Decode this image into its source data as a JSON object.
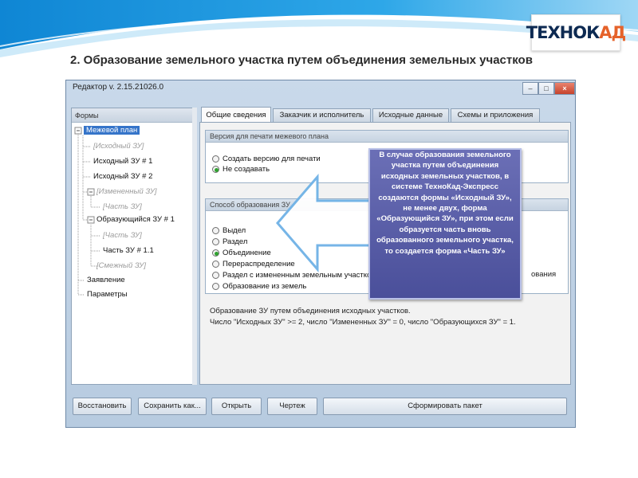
{
  "slide": {
    "logo_tekhno": "ТЕХНО",
    "logo_k": "К",
    "logo_ad": "АД",
    "title": "2. Образование земельного участка путем объединения земельных участков"
  },
  "window": {
    "title": "Редактор v. 2.15.21026.0",
    "min_label": "–",
    "max_label": "□",
    "close_label": "×"
  },
  "tree": {
    "header": "Формы",
    "items": [
      {
        "label": "Межевой план",
        "style": "selected"
      },
      {
        "label": "[Исходный ЗУ]",
        "style": "ghost"
      },
      {
        "label": "Исходный ЗУ # 1",
        "style": "normal"
      },
      {
        "label": "Исходный ЗУ # 2",
        "style": "normal"
      },
      {
        "label": "[Измененный ЗУ]",
        "style": "ghost"
      },
      {
        "label": "[Часть ЗУ]",
        "style": "ghost"
      },
      {
        "label": "Образующийся ЗУ # 1",
        "style": "normal"
      },
      {
        "label": "[Часть ЗУ]",
        "style": "ghost"
      },
      {
        "label": "Часть ЗУ # 1.1",
        "style": "normal"
      },
      {
        "label": "[Смежный ЗУ]",
        "style": "ghost"
      },
      {
        "label": "Заявление",
        "style": "normal"
      },
      {
        "label": "Параметры",
        "style": "normal"
      }
    ]
  },
  "tabs": [
    {
      "label": "Общие сведения",
      "active": true
    },
    {
      "label": "Заказчик и исполнитель",
      "active": false
    },
    {
      "label": "Исходные данные",
      "active": false
    },
    {
      "label": "Схемы и приложения",
      "active": false
    }
  ],
  "print_version": {
    "header": "Версия для печати межевого плана",
    "options": [
      {
        "label": "Создать версию для печати",
        "checked": false
      },
      {
        "label": "Не создавать",
        "checked": true
      }
    ]
  },
  "method": {
    "header": "Способ образования ЗУ",
    "options": [
      {
        "label": "Выдел",
        "checked": false
      },
      {
        "label": "Раздел",
        "checked": false
      },
      {
        "label": "Объединение",
        "checked": true
      },
      {
        "label": "Перераспределение",
        "checked": false
      },
      {
        "label": "Раздел с измененным земельным участком",
        "checked": false
      },
      {
        "label": "Образование из земель",
        "checked": false
      }
    ],
    "trailing_text": "ования",
    "note_line1": "Образование ЗУ путем объединения исходных участков.",
    "note_line2": "Число \"Исходных ЗУ\" >= 2, число \"Измененных ЗУ\" = 0, число \"Образующихся ЗУ\" = 1."
  },
  "buttons": {
    "restore": "Восстановить",
    "save_as": "Сохранить как...",
    "open": "Открыть",
    "drawing": "Чертеж",
    "build_package": "Сформировать пакет"
  },
  "callout": {
    "text": "В случае образования земельного участка путем объединения исходных земельных участков, в системе ТехноКад-Экспресс создаются формы «Исходный ЗУ», не менее двух, форма «Образующийся ЗУ», при этом если образуется часть вновь образованного земельного участка, то создается форма «Часть ЗУ»"
  },
  "colors": {
    "band_blue": "#1e9be0",
    "callout_bg": "#4a4f9a",
    "selected_bg": "#3574c9",
    "radio_checked": "#2fa12f"
  }
}
